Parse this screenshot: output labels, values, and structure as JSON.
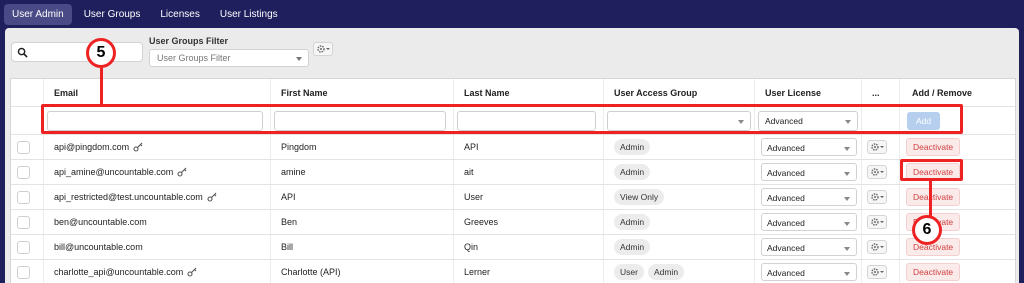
{
  "nav": {
    "tabs": [
      {
        "label": "User Admin",
        "active": true
      },
      {
        "label": "User Groups",
        "active": false
      },
      {
        "label": "Licenses",
        "active": false
      },
      {
        "label": "User Listings",
        "active": false
      }
    ]
  },
  "toolbar": {
    "search_value": "",
    "search_icon": "search-icon",
    "user_groups_filter_label": "User Groups Filter",
    "user_groups_filter_placeholder": "User Groups Filter",
    "settings_icon": "gear-icon"
  },
  "table": {
    "headers": {
      "email": "Email",
      "first_name": "First Name",
      "last_name": "Last Name",
      "user_access_group": "User Access Group",
      "user_license": "User License",
      "more": "...",
      "add_remove": "Add / Remove"
    },
    "filter_row": {
      "license_value": "Advanced",
      "add_label": "Add"
    },
    "rows": [
      {
        "email": "api@pingdom.com",
        "has_key": true,
        "first_name": "Pingdom",
        "last_name": "API",
        "groups": [
          "Admin"
        ],
        "license": "Advanced",
        "action": "Deactivate"
      },
      {
        "email": "api_amine@uncountable.com",
        "has_key": true,
        "first_name": "amine",
        "last_name": "ait",
        "groups": [
          "Admin"
        ],
        "license": "Advanced",
        "action": "Deactivate"
      },
      {
        "email": "api_restricted@test.uncountable.com",
        "has_key": true,
        "first_name": "API",
        "last_name": "User",
        "groups": [
          "View Only"
        ],
        "license": "Advanced",
        "action": "Deactivate"
      },
      {
        "email": "ben@uncountable.com",
        "has_key": false,
        "first_name": "Ben",
        "last_name": "Greeves",
        "groups": [
          "Admin"
        ],
        "license": "Advanced",
        "action": "Deactivate"
      },
      {
        "email": "bill@uncountable.com",
        "has_key": false,
        "first_name": "Bill",
        "last_name": "Qin",
        "groups": [
          "Admin"
        ],
        "license": "Advanced",
        "action": "Deactivate"
      },
      {
        "email": "charlotte_api@uncountable.com",
        "has_key": true,
        "first_name": "Charlotte (API)",
        "last_name": "Lerner",
        "groups": [
          "User",
          "Admin"
        ],
        "license": "Advanced",
        "action": "Deactivate"
      }
    ]
  },
  "annotations": {
    "callout_5": "5",
    "callout_6": "6",
    "highlight_color": "#ee2222"
  }
}
